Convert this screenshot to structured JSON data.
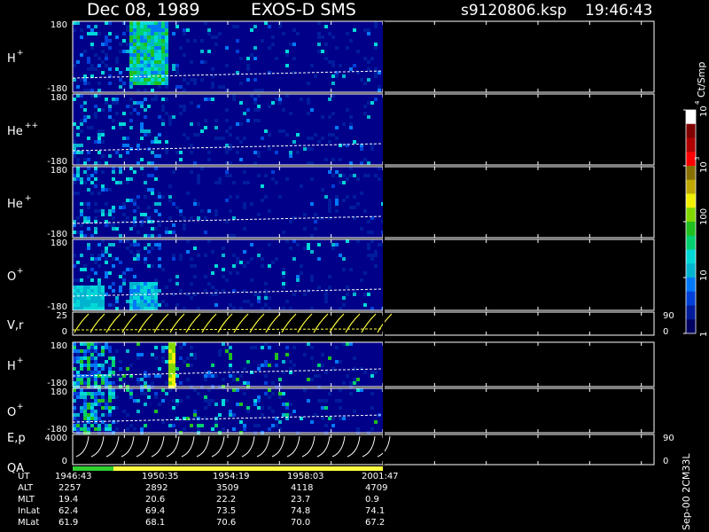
{
  "header": {
    "date": "Dec 08, 1989",
    "instrument": "EXOS-D SMS",
    "file": "s9120806.ksp",
    "time": "19:46:43"
  },
  "panels": [
    {
      "id": "h-plus",
      "label": "H",
      "sup": "+",
      "ytop": "180",
      "ybottom": "-180"
    },
    {
      "id": "he-plus-plus",
      "label": "He",
      "sup": "++",
      "ytop": "180",
      "ybottom": "-180"
    },
    {
      "id": "he-plus",
      "label": "He",
      "sup": "+",
      "ytop": "180",
      "ybottom": "-180"
    },
    {
      "id": "o-plus",
      "label": "O",
      "sup": "+",
      "ytop": "180",
      "ybottom": "-180"
    },
    {
      "id": "v-r",
      "label": "V,r",
      "sup": "",
      "ytop": "25",
      "ybottom": "0",
      "rtop": "90",
      "rbottom": "0"
    },
    {
      "id": "h-plus-2",
      "label": "H",
      "sup": "+",
      "ytop": "180",
      "ybottom": "-180"
    },
    {
      "id": "o-plus-2",
      "label": "O",
      "sup": "+",
      "ytop": "180",
      "ybottom": "-180"
    },
    {
      "id": "e-p",
      "label": "E,p",
      "sup": "",
      "label2": "QA",
      "ytop": "4000",
      "ybottom": "0",
      "rtop": "90",
      "rbottom": "0"
    }
  ],
  "colorbar": {
    "title": "Ct/Smp",
    "ticks": [
      {
        "label": "1",
        "v": 0
      },
      {
        "label": "10",
        "v": 1
      },
      {
        "label": "100",
        "v": 2
      },
      {
        "label": "10",
        "sup": "3",
        "v": 3
      },
      {
        "label": "10",
        "sup": "4",
        "v": 4
      }
    ],
    "colors": [
      "#000060",
      "#001c9c",
      "#0040d8",
      "#0078f8",
      "#00b4d0",
      "#00d8d8",
      "#00d070",
      "#20c020",
      "#80d800",
      "#f0f000",
      "#c0a800",
      "#887000",
      "#ff0000",
      "#b00000",
      "#800000",
      "#ffffff"
    ]
  },
  "footer": {
    "rows": [
      {
        "label": "UT",
        "values": [
          "1946:43",
          "1950:35",
          "1954:19",
          "1958:03",
          "2001:47"
        ]
      },
      {
        "label": "ALT",
        "values": [
          "2257",
          "2892",
          "3509",
          "4118",
          "4709"
        ]
      },
      {
        "label": "MLT",
        "values": [
          "19.4",
          "20.6",
          "22.2",
          "23.7",
          "0.9"
        ]
      },
      {
        "label": "InLat",
        "values": [
          "62.4",
          "69.4",
          "73.5",
          "74.8",
          "74.1"
        ]
      },
      {
        "label": "MLat",
        "values": [
          "61.9",
          "68.1",
          "70.6",
          "70.0",
          "67.2"
        ]
      }
    ],
    "side_text": "Sep-00 2CM33L"
  },
  "chart_data": {
    "type": "heatmap",
    "x_ticks": [
      "1946:43",
      "1950:35",
      "1954:19",
      "1958:03",
      "2001:47"
    ],
    "data_coverage_fraction": 0.5,
    "colors": {
      "background": "#000088",
      "axis": "#ffffff",
      "trace": "#ffff40",
      "quality_good": "#30d030",
      "quality_fair": "#ffff40"
    }
  }
}
